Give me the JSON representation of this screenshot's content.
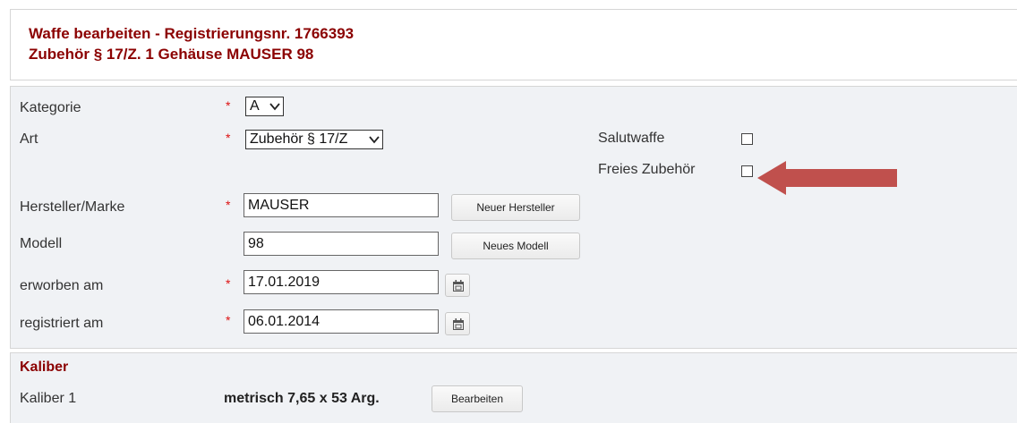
{
  "header": {
    "title_line1": "Waffe bearbeiten - Registrierungsnr. 1766393",
    "title_line2": "Zubehör § 17/Z. 1 Gehäuse MAUSER 98"
  },
  "form": {
    "required_marker": "*",
    "kategorie": {
      "label": "Kategorie",
      "value": "A"
    },
    "art": {
      "label": "Art",
      "value": "Zubehör § 17/Z"
    },
    "salutwaffe": {
      "label": "Salutwaffe",
      "checked": false
    },
    "freies_zubehoer": {
      "label": "Freies Zubehör",
      "checked": false
    },
    "hersteller": {
      "label": "Hersteller/Marke",
      "value": "MAUSER",
      "button": "Neuer Hersteller"
    },
    "modell": {
      "label": "Modell",
      "value": "98",
      "button": "Neues Modell"
    },
    "erworben": {
      "label": "erworben am",
      "value": "17.01.2019"
    },
    "registriert": {
      "label": "registriert am",
      "value": "06.01.2014"
    }
  },
  "kaliber": {
    "title": "Kaliber",
    "label": "Kaliber 1",
    "value": "metrisch 7,65 x 53 Arg.",
    "button": "Bearbeiten"
  },
  "annotation": {
    "arrow_color": "#c0504d"
  },
  "icons": {
    "calendar": "calendar-icon",
    "chevron": "chevron-down-icon",
    "arrow": "arrow-left-icon"
  }
}
